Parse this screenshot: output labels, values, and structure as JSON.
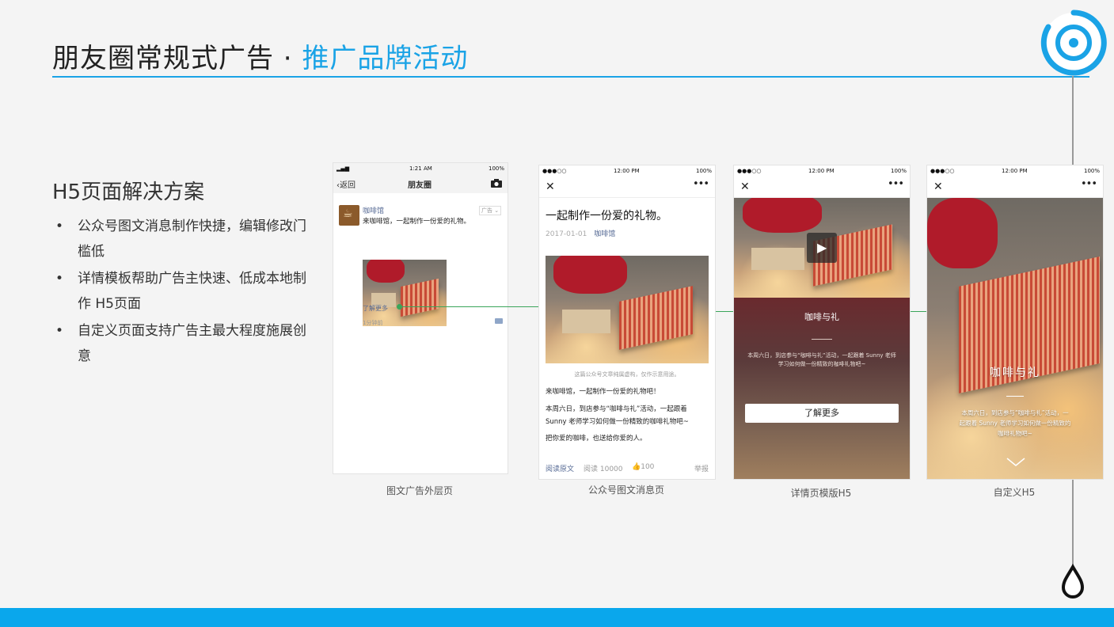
{
  "slide": {
    "title_main": "朋友圈常规式广告 · ",
    "title_highlight": "推广品牌活动",
    "accent_color": "#1aa3e6",
    "bottom_bar_color": "#0aa7ec"
  },
  "solution": {
    "title": "H5页面解决方案",
    "bullets": [
      "公众号图文消息制作快捷，编辑修改门槛低",
      "详情模板帮助广告主快速、低成本地制作 H5页面",
      "自定义页面支持广告主最大程度施展创意"
    ],
    "bullet_mark": "•"
  },
  "phone1": {
    "status_time": "1:21 AM",
    "status_battery": "100%",
    "back_label": "返回",
    "nav_title": "朋友圈",
    "camera_icon": "camera-icon",
    "account_name": "咖啡馆",
    "ad_tag": "广告 ⌄",
    "post_text": "来咖啡馆，一起制作一份爱的礼物。",
    "learn_more": "了解更多",
    "time_ago": "1分钟前",
    "caption": "图文广告外层页"
  },
  "phone2": {
    "status_time": "12:00 PM",
    "status_battery": "100%",
    "article_title": "一起制作一份爱的礼物。",
    "date": "2017-01-01",
    "account": "咖啡馆",
    "disclaimer": "这篇公众号文章纯属虚构，仅作示意用途。",
    "para1": "来咖啡馆，一起制作一份爱的礼物吧！",
    "para2": "本周六日，到店参与“咖啡与礼”活动，一起跟着 Sunny 老师学习如何做一份精致的咖啡礼物吧~",
    "para3": "把你爱的咖啡，也送给你爱的人。",
    "read_original": "阅读原文",
    "reads": "阅读 10000",
    "likes": "100",
    "report": "举报",
    "caption": "公众号图文消息页"
  },
  "phone3": {
    "status_time": "12:00 PM",
    "status_battery": "100%",
    "heading": "咖啡与礼",
    "desc": "本周六日，到店参与“咖啡与礼”活动，一起跟着 Sunny 老师学习如何做一份精致的咖啡礼物吧~",
    "button": "了解更多",
    "caption": "详情页模版H5"
  },
  "phone4": {
    "status_time": "12:00 PM",
    "status_battery": "100%",
    "heading": "咖啡与礼",
    "desc": "本周六日，到店参与“咖啡与礼”活动，一起跟着 Sunny 老师学习如何做一份精致的咖啡礼物吧~",
    "caption": "自定义H5"
  }
}
